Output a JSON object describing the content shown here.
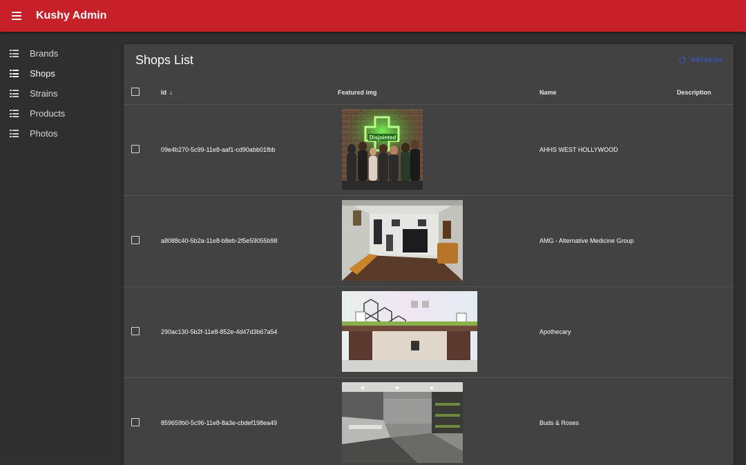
{
  "app": {
    "title": "Kushy Admin",
    "accent_color": "#c62029"
  },
  "sidebar": {
    "items": [
      {
        "label": "Brands",
        "icon": "list-icon",
        "active": false
      },
      {
        "label": "Shops",
        "icon": "list-icon",
        "active": true
      },
      {
        "label": "Strains",
        "icon": "list-icon",
        "active": false
      },
      {
        "label": "Products",
        "icon": "list-icon",
        "active": false
      },
      {
        "label": "Photos",
        "icon": "list-icon",
        "active": false
      }
    ]
  },
  "main": {
    "title": "Shops List",
    "refresh_label": "REFRESH",
    "refresh_icon": "refresh-icon",
    "columns": [
      "Id",
      "Featured img",
      "Name",
      "Description"
    ],
    "sort_column": "Id",
    "rows": [
      {
        "id": "09e4b270-5c99-11e8-aaf1-cd90abb01fbb",
        "name": "AHHS WEST HOLLYWOOD",
        "image": "storefront photo with green neon cross sign reading Disjointed"
      },
      {
        "id": "a8088c40-5b2a-11e8-b8eb-2f5e59055b98",
        "name": "AMG - Alternative Medicine Group",
        "image": "dispensary lobby photo"
      },
      {
        "id": "290ac130-5b2f-11e8-852e-4d47d3b67a54",
        "name": "Apothecary",
        "image": "dispensary counter photo"
      },
      {
        "id": "859659b0-5c96-11e8-8a3e-cbdef198ea49",
        "name": "Buds & Roses",
        "image": "dispensary interior photo"
      }
    ]
  }
}
